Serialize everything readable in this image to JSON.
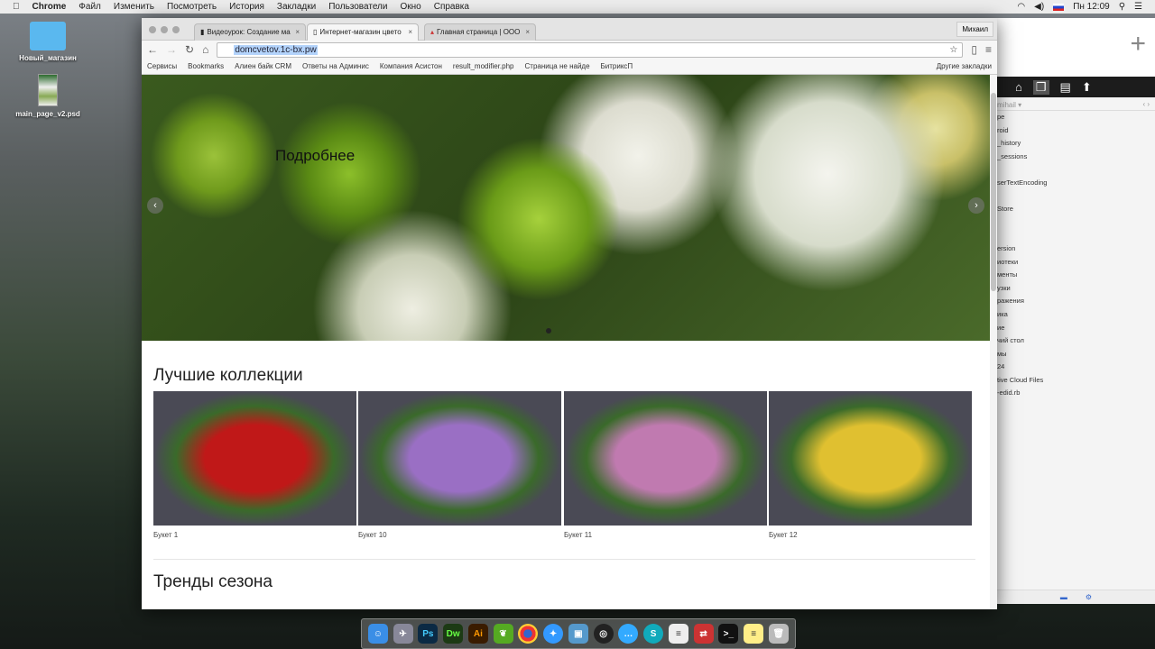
{
  "menubar": {
    "app": "Chrome",
    "items": [
      "Файл",
      "Изменить",
      "Посмотреть",
      "История",
      "Закладки",
      "Пользователи",
      "Окно",
      "Справка"
    ],
    "clock": "Пн 12:09"
  },
  "desktop": {
    "icons": [
      {
        "label": "Новый_магазин"
      },
      {
        "label": "main_page_v2.psd"
      }
    ]
  },
  "browser": {
    "tabs": [
      {
        "title": "Видеоурок: Создание ма"
      },
      {
        "title": "Интернет-магазин цвето"
      },
      {
        "title": "Главная страница | ООО"
      }
    ],
    "user": "Михаил",
    "url": "domcvetov.1c-bx.pw",
    "bookmarks": [
      "Сервисы",
      "Bookmarks",
      "Алиен байк CRM",
      "Ответы на Админис",
      "Компания Асистон",
      "result_modifier.php",
      "Страница не найде",
      "БитриксП"
    ],
    "other_bookmarks": "Другие закладки"
  },
  "page": {
    "hero": {
      "link": "Подробнее",
      "prev": "‹",
      "next": "›"
    },
    "collections_title": "Лучшие коллекции",
    "products": [
      {
        "name": "Букет 1",
        "color": "#c01818"
      },
      {
        "name": "Букет 10",
        "color": "#9a6fc4"
      },
      {
        "name": "Букет 11",
        "color": "#c07ab0"
      },
      {
        "name": "Букет 12",
        "color": "#e0c030"
      }
    ],
    "trends_title": "Тренды сезона"
  },
  "finder": {
    "path": "mihail",
    "files": [
      "pe",
      "roid",
      "_history",
      "_sessions",
      "",
      "serTextEncoding",
      "",
      "Store",
      "",
      "",
      "ersion",
      "иотеки",
      "менты",
      "узки",
      "ражения",
      "ика",
      "ие",
      "чий стол",
      "мы",
      "24",
      "tive Cloud Files",
      "-edid.rb",
      ""
    ]
  },
  "dock": [
    "Ps",
    "Dw",
    "Ai"
  ]
}
